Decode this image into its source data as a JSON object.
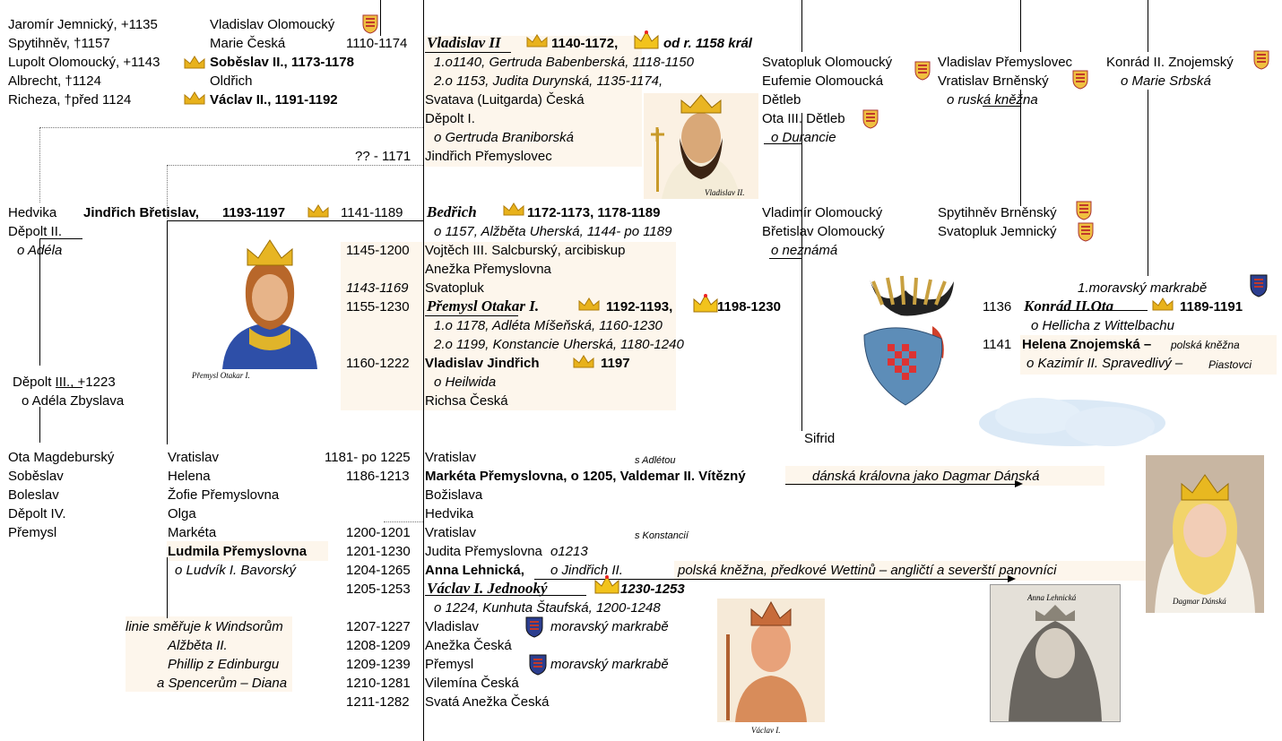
{
  "col_left_top": [
    "Jaromír Jemnický, +1135",
    "Spytihněv, †1157",
    "Lupolt Olomoucký, +1143",
    "Albrecht, †1124",
    "Richeza, †před 1124"
  ],
  "col_left2_top": [
    "Vladislav Olomoucký",
    "Marie Česká",
    "Soběslav II., 1173-1178",
    "Oldřich",
    "Václav II., 1191-1192"
  ],
  "vlad2": {
    "years": "1110-1174",
    "name": "Vladislav II",
    "reign": "1140-1172,",
    "king": "od r. 1158 král",
    "m1": "1.o1140, Gertruda Babenberská, 1118-1150",
    "m2": "2.o 1153, Judita Durynská, 1135-1174,"
  },
  "vlad2_children": [
    "Svatava (Luitgarda) Česká",
    "Děpolt I.",
    "o Gertruda Braniborská"
  ],
  "jindrich_p": {
    "years": "?? - 1171",
    "name": "Jindřich Přemyslovec"
  },
  "col_mid_top": [
    "Svatopluk Olomoucký",
    "Eufemie Olomoucká",
    "Dětleb",
    "Ota III. Dětleb",
    "o Durancie"
  ],
  "col_right1_top": [
    "Vladislav Přemyslovec",
    "Vratislav Brněnský",
    "o ruská kněžna"
  ],
  "col_right2_top": [
    "Konrád II. Znojemský",
    "o Marie Srbská"
  ],
  "hedvika": [
    "Hedvika",
    "Děpolt II.",
    "o Adéla"
  ],
  "jindrich_bretislav": {
    "name": "Jindřich Břetislav,",
    "reign": "1193-1197"
  },
  "bedrich": {
    "years": "1141-1189",
    "name": "Bedřich",
    "reign": "1172-1173, 1178-1189",
    "m": "o 1157, Alžběta Uherská, 1144- po 1189"
  },
  "siblings": [
    {
      "years": "1145-1200",
      "name": "Vojtěch III. Salcburský, arcibiskup"
    },
    {
      "years": "",
      "name": "Anežka Přemyslovna"
    },
    {
      "years": "1143-1169",
      "name": "Svatopluk"
    }
  ],
  "otakar": {
    "years": "1155-1230",
    "name": "Přemysl Otakar I.",
    "reign": "1192-1193,",
    "king": "1198-1230",
    "m1": "1.o 1178, Adléta Míšeňská, 1160-1230",
    "m2": "2.o 1199, Konstancie Uherská, 1180-1240"
  },
  "vlad_jindrich": {
    "years": "1160-1222",
    "name": "Vladislav Jindřich",
    "reign": "1197",
    "m": "o Heilwida"
  },
  "richsa": "Richsa Česká",
  "col_mid_mid": [
    "Vladimír Olomoucký",
    "Břetislav Olomoucký",
    "o neznámá"
  ],
  "col_right_mid": [
    "Spytihněv Brněnský",
    "Svatopluk Jemnický"
  ],
  "konrad_ota": {
    "title": "1.moravský markrabě",
    "years": "1136",
    "name": "Konrád II.Ota",
    "reign": "1189-1191",
    "m": "o Hellicha z Wittelbachu"
  },
  "helena": {
    "years": "1141",
    "name": "Helena Znojemská –",
    "note": "polská kněžna",
    "m": "o Kazimír II. Spravedlivý –",
    "dyn": "Piastovci"
  },
  "depolt3": [
    "Děpolt III.,  +1223",
    "o Adéla Zbyslava"
  ],
  "sifrid": "Sifrid",
  "col_left_bottom": [
    "Ota Magdeburský",
    "Soběslav",
    "Boleslav",
    "Děpolt IV.",
    "Přemysl"
  ],
  "col_left2_bottom": [
    "Vratislav",
    "Helena",
    "Žofie Přemyslovna",
    "Olga",
    "Markéta",
    "Ludmila Přemyslovna",
    "o Ludvík I. Bavorský"
  ],
  "windsor": [
    "linie směřuje k Windsorům",
    "Alžběta II.",
    "Phillip z Edinburgu",
    "a Spencerům – Diana"
  ],
  "children1": [
    {
      "years": "1181- po 1225",
      "name": "Vratislav"
    },
    {
      "years": "1186-1213",
      "name": "Markéta Přemyslovna, o 1205, Valdemar II. Vítězný"
    },
    {
      "years": "",
      "name": "Božislava"
    },
    {
      "years": "",
      "name": "Hedvika"
    }
  ],
  "s_adletou": "s Adlétou",
  "dagmar_note": "dánská královna jako Dagmar Dánská",
  "s_konstanci": "s Konstancií",
  "children2": [
    {
      "years": "1200-1201",
      "name": "Vratislav"
    },
    {
      "years": "1201-1230",
      "name": "Judita Přemyslovna",
      "suffix": "o1213"
    },
    {
      "years": "1204-1265",
      "name": "Anna Lehnická,",
      "suffix": "o Jindřich II."
    }
  ],
  "anna_note": "polská kněžna, předkové Wettinů – angličtí a severští panovníci",
  "vaclav1": {
    "years": "1205-1253",
    "name": "Václav I. Jednooký",
    "reign": "1230-1253",
    "m": "o 1224, Kunhuta Štaufská, 1200-1248"
  },
  "children3": [
    {
      "years": "1207-1227",
      "name": "Vladislav",
      "note": "moravský markrabě"
    },
    {
      "years": "1208-1209",
      "name": "Anežka Česká",
      "note": ""
    },
    {
      "years": "1209-1239",
      "name": "Přemysl",
      "note": "moravský markrabě"
    },
    {
      "years": "1210-1281",
      "name": "Vilemína Česká",
      "note": ""
    },
    {
      "years": "1211-1282",
      "name": "Svatá Anežka Česká",
      "note": ""
    }
  ],
  "captions": {
    "vladislav": "Vladislav II.",
    "otakar": "Přemysl Otakar I.",
    "vaclav": "Václav I.",
    "anna": "Anna Lehnická",
    "dagmar": "Dagmar Dánská"
  },
  "colors": {
    "paper": "#fdf6ec",
    "crown": "#e8b21c",
    "eagle_red": "#c0392b",
    "eagle_blue": "#2c3e8f"
  }
}
